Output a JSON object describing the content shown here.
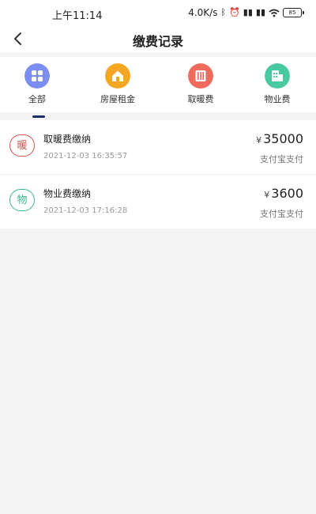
{
  "status_bar": {
    "time": "上午11:14",
    "network_speed": "4.0K/s",
    "icons": [
      "bluetooth-icon",
      "alarm-icon",
      "signal-icon",
      "signal-icon",
      "wifi-icon"
    ],
    "battery": "85"
  },
  "nav": {
    "title": "缴费记录",
    "back_icon": "chevron-left-icon"
  },
  "tabs": [
    {
      "label": "全部",
      "icon": "grid-icon",
      "color": "#7c8ff0",
      "active": true
    },
    {
      "label": "房屋租金",
      "icon": "house-icon",
      "color": "#f5a623",
      "active": false
    },
    {
      "label": "取暖费",
      "icon": "heater-icon",
      "color": "#ee6b5e",
      "active": false
    },
    {
      "label": "物业费",
      "icon": "property-icon",
      "color": "#49c9a0",
      "active": false
    }
  ],
  "records": [
    {
      "badge": "暖",
      "badge_color": "#d9534f",
      "title": "取暖费缴纳",
      "time": "2021-12-03 16:35:57",
      "currency": "¥",
      "amount": "35000",
      "method": "支付宝支付"
    },
    {
      "badge": "物",
      "badge_color": "#3fb68b",
      "title": "物业费缴纳",
      "time": "2021-12-03 17:16:28",
      "currency": "¥",
      "amount": "3600",
      "method": "支付宝支付"
    }
  ],
  "colors": {
    "accent": "#1f2f6b",
    "background": "#f3f3f3"
  }
}
